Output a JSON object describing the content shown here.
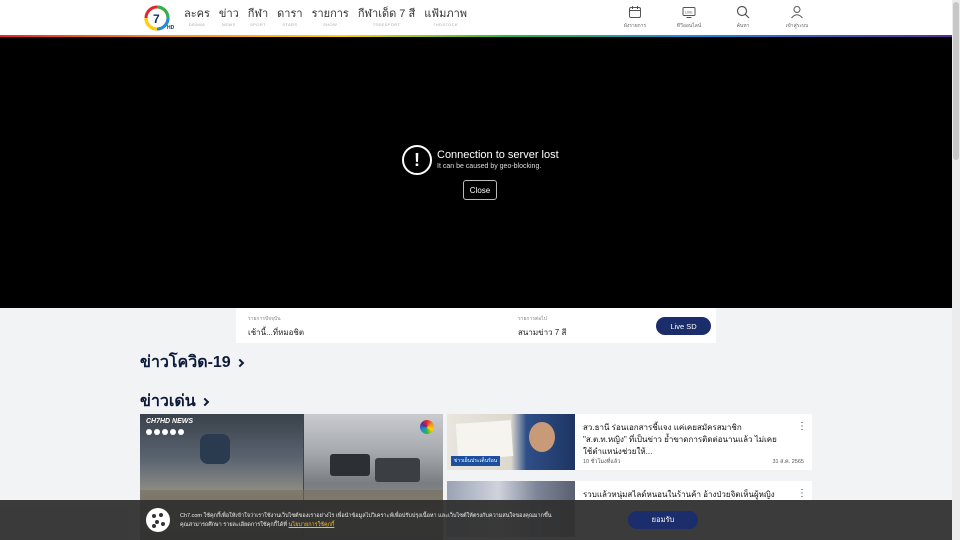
{
  "header": {
    "nav": [
      {
        "label": "ละคร",
        "sub": "DRAMA"
      },
      {
        "label": "ข่าว",
        "sub": "NEWS"
      },
      {
        "label": "กีฬา",
        "sub": "SPORT"
      },
      {
        "label": "ดารา",
        "sub": "STARS"
      },
      {
        "label": "รายการ",
        "sub": "SHOW"
      },
      {
        "label": "กีฬาเด็ด 7 สี",
        "sub": "7SEESPORT"
      },
      {
        "label": "แฟ้มภาพ",
        "sub": "7HDSTOCK"
      }
    ],
    "tools": [
      {
        "label": "ผังรายการ",
        "icon": "calendar-icon"
      },
      {
        "label": "ทีวีออนไลน์",
        "icon": "tv-icon"
      },
      {
        "label": "ค้นหา",
        "icon": "search-icon"
      },
      {
        "label": "เข้าสู่ระบบ",
        "icon": "user-icon"
      }
    ]
  },
  "player": {
    "error_title": "Connection to server lost",
    "error_sub": "It can be caused by geo-blocking.",
    "close_label": "Close"
  },
  "schedule": {
    "now_caption": "รายการปัจจุบัน",
    "now_title": "เช้านี้...ที่หมอชิต",
    "next_caption": "รายการต่อไป",
    "next_title": "สนามข่าว 7 สี",
    "live_label": "Live SD"
  },
  "sections": {
    "covid": "ข่าวโควิด-19",
    "highlight": "ข่าวเด่น"
  },
  "featured": {
    "brand": "CH7HD NEWS"
  },
  "cards": [
    {
      "title": "สว.ธานี ร่อนเอกสารชี้แจง แค่เคยสมัครสมาชิก \"ส.ต.ท.หญิง\" ที่เป็นข่าว ย้ำขาดการติดต่อนานแล้ว ไม่เคยใช้ตำแหน่งช่วยให้...",
      "meta": "10 ชั่วโมงที่แล้ว",
      "date": "31 ส.ค. 2565",
      "tag": "ข่าวเย็นประเด็นร้อน"
    },
    {
      "title": "รวบแล้วหนุ่มสไลด์หนอนในร้านค้า อ้างป่วยจิตเห็นผู้หญิง",
      "meta": "",
      "date": "",
      "tag": ""
    }
  ],
  "cookie": {
    "text": "Ch7.com ใช้คุกกี้เพื่อให้เข้าใจว่าเราใช้งานเว็บไซต์ของเราอย่างไร เพื่อนำข้อมูลไปวิเคราะห์เพื่อปรับปรุงเนื้อหา และเว็บไซต์ให้ตรงกับความสนใจของคุณมากขึ้น คุณสามารถศึกษา รายละเอียดการใช้คุกกี้ได้ที่ ",
    "link": "นโยบายการใช้คุกกี้",
    "accept_label": "ยอมรับ"
  },
  "colors": {
    "navy": "#1b2d6b",
    "cookie_link": "#f3c21b"
  }
}
